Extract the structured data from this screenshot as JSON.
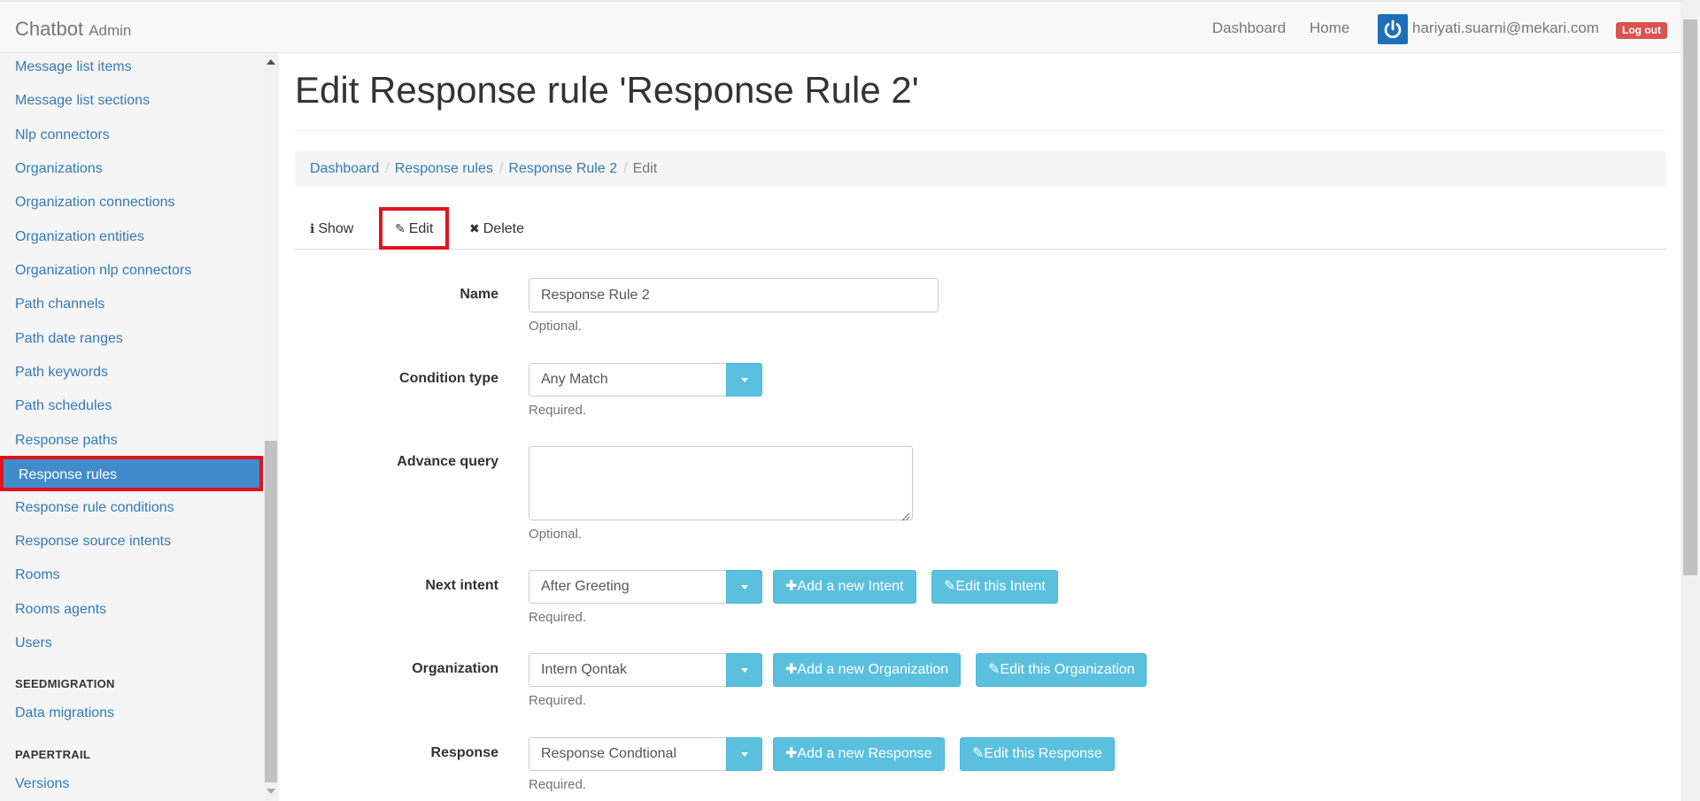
{
  "navbar": {
    "brand": "Chatbot",
    "brand_sub": "Admin",
    "links": [
      "Dashboard",
      "Home"
    ],
    "user_email": "hariyati.suarni@mekari.com",
    "logout": "Log out"
  },
  "sidebar": {
    "items": [
      "Message list items",
      "Message list sections",
      "Nlp connectors",
      "Organizations",
      "Organization connections",
      "Organization entities",
      "Organization nlp connectors",
      "Path channels",
      "Path date ranges",
      "Path keywords",
      "Path schedules",
      "Response paths",
      "Response rules",
      "Response rule conditions",
      "Response source intents",
      "Rooms",
      "Rooms agents",
      "Users"
    ],
    "active_item": "Response rules",
    "section_seed": "SEEDMIGRATION",
    "seed_items": [
      "Data migrations"
    ],
    "section_paper": "PAPERTRAIL",
    "paper_items": [
      "Versions"
    ]
  },
  "main": {
    "title": "Edit Response rule 'Response Rule 2'",
    "breadcrumb": [
      "Dashboard",
      "Response rules",
      "Response Rule 2",
      "Edit"
    ],
    "tabs": {
      "show": "Show",
      "edit": "Edit",
      "delete": "Delete"
    }
  },
  "form": {
    "name": {
      "label": "Name",
      "value": "Response Rule 2",
      "help": "Optional."
    },
    "condition_type": {
      "label": "Condition type",
      "value": "Any Match",
      "help": "Required."
    },
    "advance_query": {
      "label": "Advance query",
      "value": "",
      "help": "Optional."
    },
    "next_intent": {
      "label": "Next intent",
      "value": "After Greeting",
      "help": "Required.",
      "add": "Add a new Intent",
      "edit": "Edit this Intent"
    },
    "organization": {
      "label": "Organization",
      "value": "Intern Qontak",
      "help": "Required.",
      "add": "Add a new Organization",
      "edit": "Edit this Organization"
    },
    "response": {
      "label": "Response",
      "value": "Response Condtional",
      "help": "Required.",
      "add": "Add a new Response",
      "edit": "Edit this Response"
    }
  },
  "colors": {
    "link": "#337ab7",
    "active_bg": "#428bca",
    "highlight_border": "#e0131f",
    "info_button": "#5bc0de",
    "danger": "#d9534f",
    "user_icon": "#1d6fb8"
  }
}
